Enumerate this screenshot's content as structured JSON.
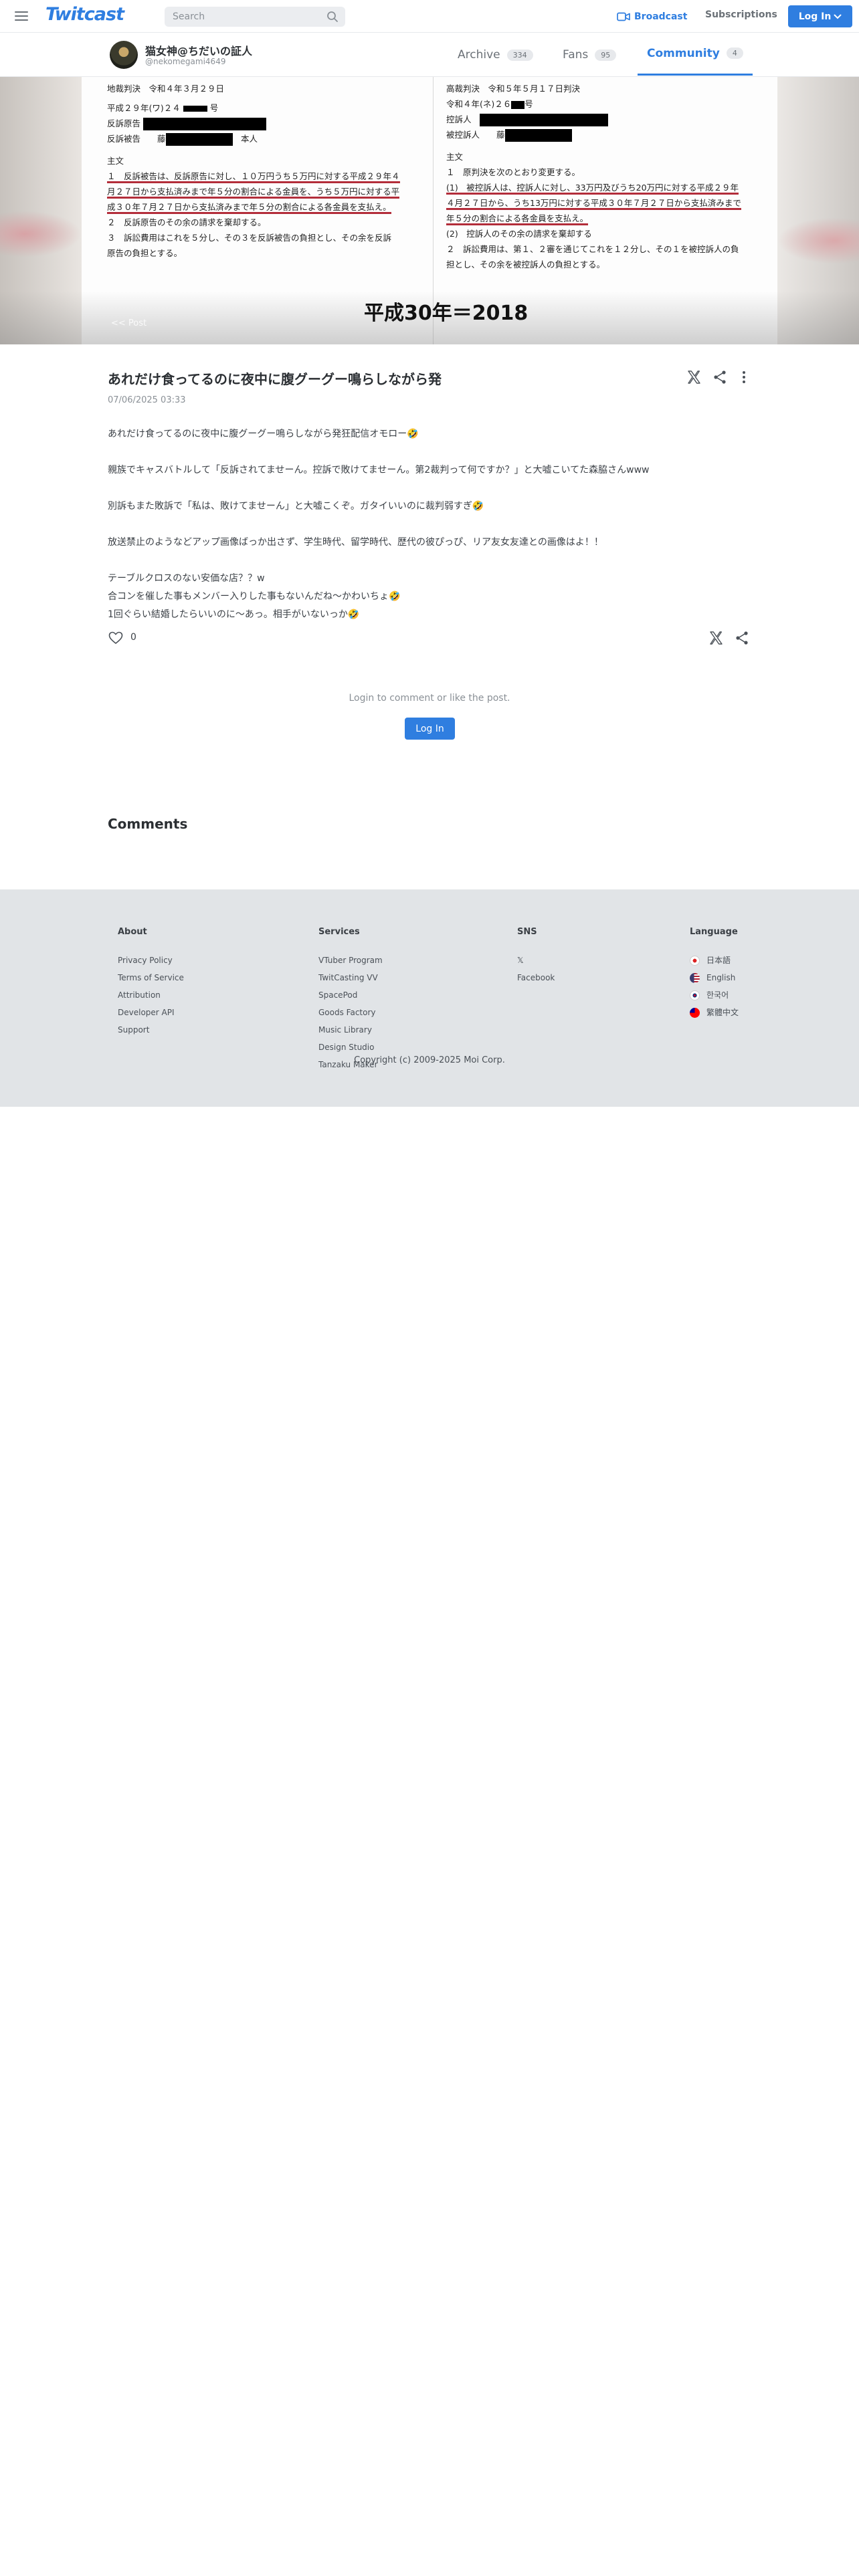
{
  "header": {
    "logo": "Twitcast",
    "search_placeholder": "Search",
    "broadcast_label": "Broadcast",
    "subscriptions_label": "Subscriptions",
    "login_label": "Log In"
  },
  "profile": {
    "name": "猫女神@ちだいの証人",
    "handle": "@nekomegami4649",
    "tabs": [
      {
        "label": "Archive",
        "count": "334"
      },
      {
        "label": "Fans",
        "count": "95"
      },
      {
        "label": "Community",
        "count": "4"
      }
    ]
  },
  "hero": {
    "left_lines": [
      "地裁判決　令和４年３月２９日",
      "平成２９年(ワ)２４",
      "反訴原告",
      "反訴被告　　藤",
      "主文",
      "１　反訴被告は、反訴原告に対し、１０万円うち５万円に対する平成２９年４",
      "月２７日から支払済みまで年５分の割合による金員を、うち５万円に対する平",
      "成３０年７月２７日から支払済みまで年５分の割合による各金員を支払え。",
      "２　反訴原告のその余の請求を棄却する。",
      "３　訴訟費用はこれを５分し、その３を反訴被告の負担とし、その余を反訴",
      "原告の負担とする。"
    ],
    "left_suffix_1": "号",
    "left_suffix_2": "本人",
    "right_lines": [
      "高裁判決　令和５年５月１７日判決",
      "令和４年(ネ)２６",
      "控訴人",
      "被控訴人　　藤",
      "主文",
      "１　原判決を次のとおり変更する。",
      "(1)　被控訴人は、控訴人に対し、33万円及びうち20万円に対する平成２９年",
      "４月２７日から、うち13万円に対する平成３０年７月２７日から支払済みまで",
      "年５分の割合による各金員を支払え。",
      "(2)　控訴人のその余の請求を棄却する",
      "２　訴訟費用は、第１、２審を通じてこれを１２分し、その１を被控訴人の負",
      "担とし、その余を被控訴人の負担とする。"
    ],
    "right_suffix_1": "号",
    "caption": "平成30年＝2018",
    "faint_text": "<<  Post"
  },
  "post": {
    "title": "あれだけ食ってるのに夜中に腹グーグー鳴らしながら発",
    "date": "07/06/2025 03:33",
    "body": [
      "あれだけ食ってるのに夜中に腹グーグー鳴らしながら発狂配信オモロー🤣",
      "",
      "親族でキャスバトルして「反訴されてませーん。控訴で敗けてませーん。第2裁判って何ですか？」と大嘘こいてた森脇さんwww",
      "",
      "別訴もまた敗訴で「私は、敗けてませーん」と大嘘こくぞ。ガタイいいのに裁判弱すぎ🤣",
      "",
      "放送禁止のようなどアップ画像ばっか出さず、学生時代、留学時代、歴代の彼ぴっぴ、リア友女友達との画像はよ！！",
      "",
      "テーブルクロスのない安価な店？？w",
      "合コンを催した事もメンバー入りした事もないんだね〜かわいちょ🤣",
      "1回ぐらい結婚したらいいのに〜あっ。相手がいないっか🤣"
    ],
    "like_count": "0"
  },
  "comments": {
    "login_prompt": "Login to comment or like the post.",
    "login_button": "Log In",
    "title": "Comments"
  },
  "footer": {
    "about": {
      "title": "About",
      "links": [
        "Privacy Policy",
        "Terms of Service",
        "Attribution",
        "Developer API",
        "Support"
      ]
    },
    "services": {
      "title": "Services",
      "links": [
        "VTuber Program",
        "TwitCasting VV",
        "SpacePod",
        "Goods Factory",
        "Music Library",
        "Design Studio",
        "Tanzaku Maker"
      ]
    },
    "sns": {
      "title": "SNS",
      "links": [
        "𝕏",
        "Facebook"
      ]
    },
    "language": {
      "title": "Language",
      "links": [
        "日本語",
        "English",
        "한국어",
        "繁體中文"
      ]
    },
    "copyright": "Copyright (c) 2009-2025 Moi Corp."
  },
  "colors": {
    "accent": "#2f7ee0",
    "underline_red": "#b32d3a",
    "footer_bg": "#e1e4e7"
  }
}
